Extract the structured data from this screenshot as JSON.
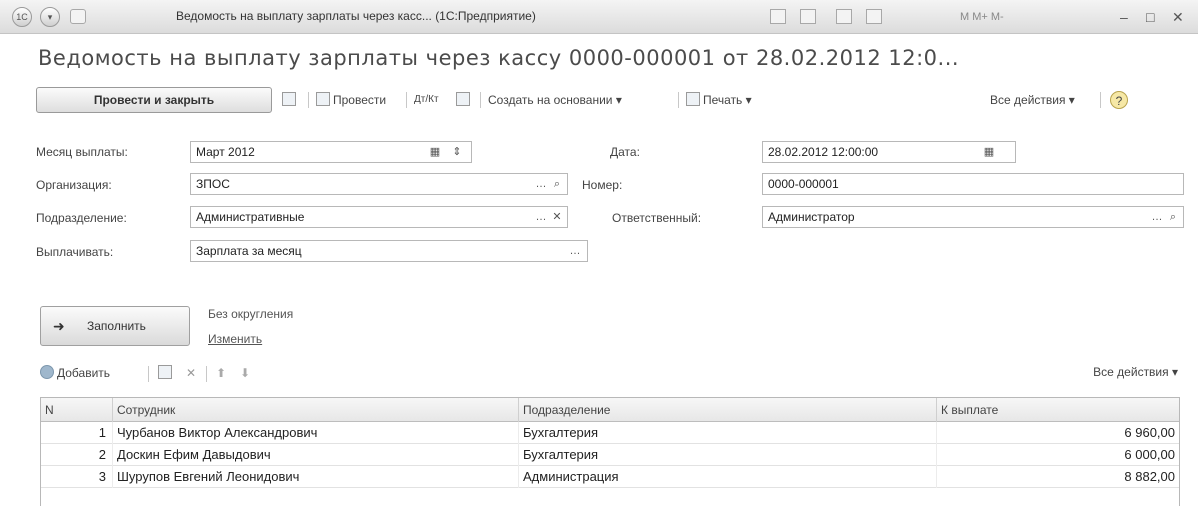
{
  "window": {
    "title": "Ведомость на выплату зарплаты через касс... (1С:Предприятие)",
    "logo": "1С",
    "window_controls": [
      "minimize",
      "restore",
      "close"
    ]
  },
  "document_title": "Ведомость на выплату зарплаты через кассу 0000-000001 от 28.02.2012 12:0...",
  "toolbar": {
    "post_close_label": "Провести и закрыть",
    "post_label": "Провести",
    "create_based_label": "Создать на основании ▾",
    "print_label": "Печать ▾",
    "all_actions_label": "Все действия ▾",
    "help_label": "?"
  },
  "form": {
    "month_label": "Месяц выплаты:",
    "month_value": "Март 2012",
    "date_label": "Дата:",
    "date_value": "28.02.2012 12:00:00",
    "org_label": "Организация:",
    "org_value": "ЗПОС",
    "number_label": "Номер:",
    "number_value": "0000-000001",
    "dept_label": "Подразделение:",
    "dept_value": "Административные",
    "responsible_label": "Ответственный:",
    "responsible_value": "Администратор",
    "pay_label": "Выплачивать:",
    "pay_value": "Зарплата за месяц"
  },
  "fill": {
    "button_label": "Заполнить",
    "rounding_text": "Без округления",
    "change_link": "Изменить"
  },
  "table_toolbar": {
    "add_label": "Добавить",
    "all_actions_label": "Все действия ▾"
  },
  "table": {
    "columns": [
      "N",
      "Сотрудник",
      "Подразделение",
      "К выплате"
    ],
    "rows": [
      {
        "n": "1",
        "employee": "Чурбанов Виктор Александрович",
        "dept": "Бухгалтерия",
        "amount": "6 960,00"
      },
      {
        "n": "2",
        "employee": "Доскин Ефим Давыдович",
        "dept": "Бухгалтерия",
        "amount": "6 000,00"
      },
      {
        "n": "3",
        "employee": "Шурупов Евгений Леонидович",
        "dept": "Администрация",
        "amount": "8 882,00"
      }
    ]
  }
}
